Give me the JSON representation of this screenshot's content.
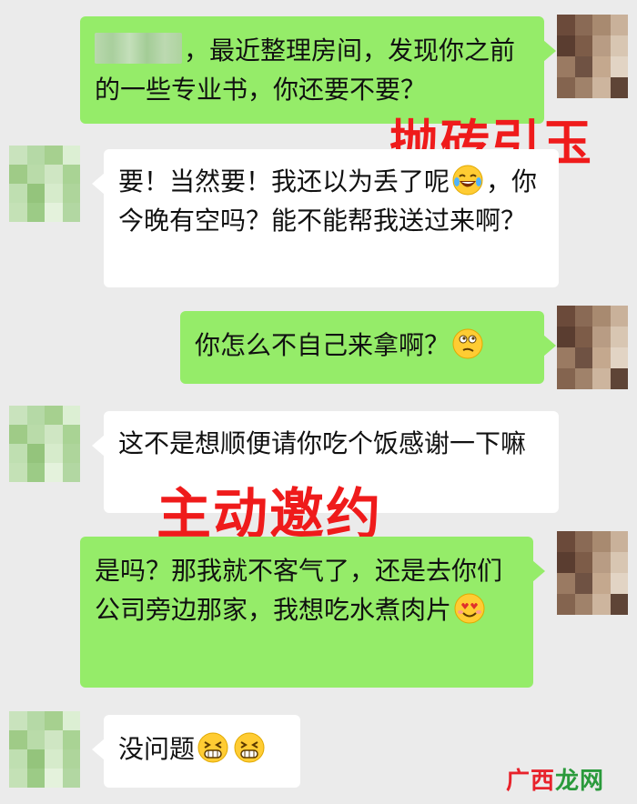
{
  "messages": [
    {
      "side": "right",
      "text": "，最近整理房间，发现你之前的一些专业书，你还要不要？"
    },
    {
      "side": "left",
      "text_before": "要！当然要！我还以为丢了呢",
      "emoji": "laughing-tears",
      "text_after": "，你今晚有空吗？能不能帮我送过来啊？"
    },
    {
      "side": "right",
      "text": "你怎么不自己来拿啊？",
      "emoji": "thinking"
    },
    {
      "side": "left",
      "text": "这不是想顺便请你吃个饭感谢一下嘛"
    },
    {
      "side": "right",
      "text": "是吗？那我就不客气了，还是去你们公司旁边那家，我想吃水煮肉片",
      "emoji": "heart-eyes"
    },
    {
      "side": "left",
      "text": "没问题",
      "emoji": "grinning"
    }
  ],
  "overlays": {
    "label_1": "抛砖引玉",
    "label_2": "主动邀约"
  },
  "watermark": {
    "part_a": "广西",
    "part_b": "龙网"
  },
  "colors": {
    "background": "#ebebeb",
    "my_bubble": "#95ec69",
    "their_bubble": "#ffffff",
    "overlay_text": "#ef1b1b"
  }
}
